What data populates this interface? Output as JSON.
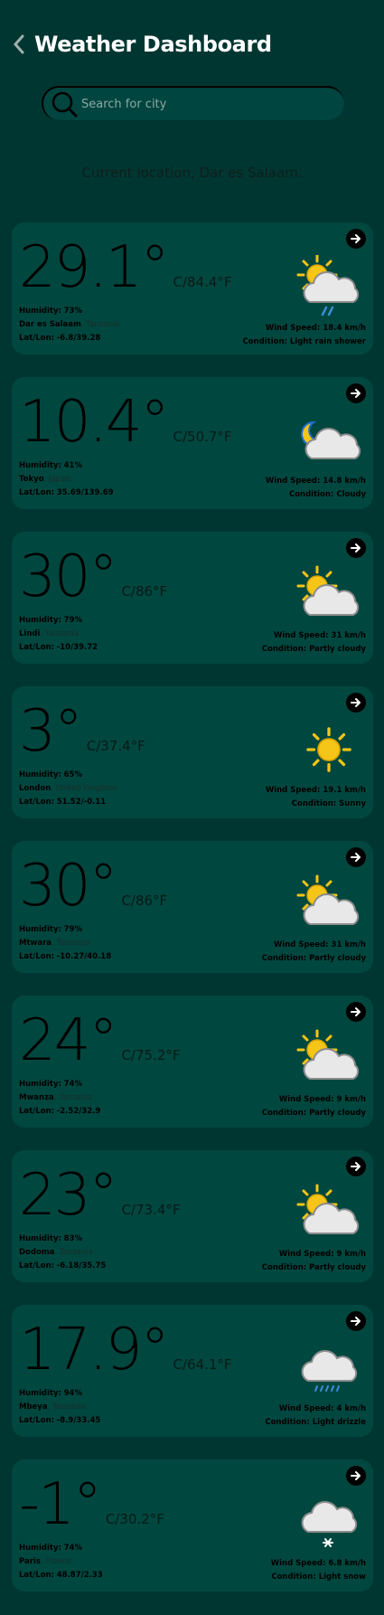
{
  "header": {
    "title": "Weather Dashboard"
  },
  "search": {
    "placeholder": "Search for city"
  },
  "location_text": "Current location, Dar es Salaam.",
  "labels": {
    "humidity": "Humidity:",
    "latlon": "Lat/Lon:",
    "wind": "Wind Speed:",
    "condition": "Condition:"
  },
  "cards": [
    {
      "temp": "29.1",
      "deg": "°",
      "unit": "C/84.4°F",
      "humidity": "73%",
      "city": "Dar es Salaam",
      "country": ", Tanzania",
      "latlon": "-6.8/39.28",
      "wind": "18.4 km/h",
      "condition": "Light rain shower",
      "icon": "sun-cloud-rain-icon"
    },
    {
      "temp": "10.4",
      "deg": "°",
      "unit": "C/50.7°F",
      "humidity": "41%",
      "city": "Tokyo",
      "country": ", Japan",
      "latlon": "35.69/139.69",
      "wind": "14.8 km/h",
      "condition": "Cloudy",
      "icon": "moon-cloud-icon"
    },
    {
      "temp": "30",
      "deg": "°",
      "unit": "C/86°F",
      "humidity": "79%",
      "city": "Lindi",
      "country": ", Tanzania",
      "latlon": "-10/39.72",
      "wind": "31 km/h",
      "condition": "Partly cloudy",
      "icon": "sun-cloud-icon"
    },
    {
      "temp": "3",
      "deg": "°",
      "unit": "C/37.4°F",
      "humidity": "65%",
      "city": "London",
      "country": ", United Kingdom",
      "latlon": "51.52/-0.11",
      "wind": "19.1 km/h",
      "condition": "Sunny",
      "icon": "sun-icon"
    },
    {
      "temp": "30",
      "deg": "°",
      "unit": "C/86°F",
      "humidity": "79%",
      "city": "Mtwara",
      "country": ", Tanzania",
      "latlon": "-10.27/40.18",
      "wind": "31 km/h",
      "condition": "Partly cloudy",
      "icon": "sun-cloud-icon"
    },
    {
      "temp": "24",
      "deg": "°",
      "unit": "C/75.2°F",
      "humidity": "74%",
      "city": "Mwanza",
      "country": ", Tanzania",
      "latlon": "-2.52/32.9",
      "wind": "9 km/h",
      "condition": "Partly cloudy",
      "icon": "sun-cloud-icon"
    },
    {
      "temp": "23",
      "deg": "°",
      "unit": "C/73.4°F",
      "humidity": "83%",
      "city": "Dodoma",
      "country": ", Tanzania",
      "latlon": "-6.18/35.75",
      "wind": "9 km/h",
      "condition": "Partly cloudy",
      "icon": "sun-cloud-icon"
    },
    {
      "temp": "17.9",
      "deg": "°",
      "unit": "C/64.1°F",
      "humidity": "94%",
      "city": "Mbeya",
      "country": ", Tanzania",
      "latlon": "-8.9/33.45",
      "wind": "4 km/h",
      "condition": "Light drizzle",
      "icon": "cloud-drizzle-icon"
    },
    {
      "temp": "-1",
      "deg": "°",
      "unit": "C/30.2°F",
      "humidity": "74%",
      "city": "Paris",
      "country": ", France",
      "latlon": "48.87/2.33",
      "wind": "6.8 km/h",
      "condition": "Light snow",
      "icon": "cloud-snow-icon"
    }
  ],
  "colors": {
    "background": "#003631",
    "card": "#00473f",
    "sun": "#f5c518",
    "cloud": "#e6e6e6",
    "rain": "#3a8fd9"
  }
}
